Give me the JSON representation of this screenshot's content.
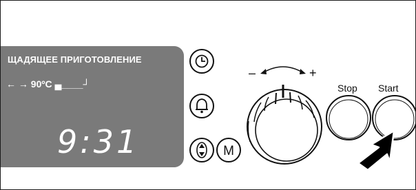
{
  "display": {
    "mode_title": "ЩАДЯЩЕЕ  ПРИГОТОВЛЕНИЕ",
    "temperature_line": "← → 90ºC ▄____┘",
    "time": "9:31"
  },
  "buttons": {
    "clock_icon": "clock-icon",
    "bell_icon": "bell-icon",
    "arrows_icon": "up-down-arrows-icon",
    "mode_label": "M",
    "stop_label": "Stop",
    "start_label": "Start"
  },
  "knob": {
    "minus": "–",
    "plus": "+"
  },
  "colors": {
    "display_bg": "#7a7a7a",
    "display_text": "#ffffff",
    "button_fill": "#ffffff",
    "outline": "#111111",
    "pointer": "#000000"
  }
}
